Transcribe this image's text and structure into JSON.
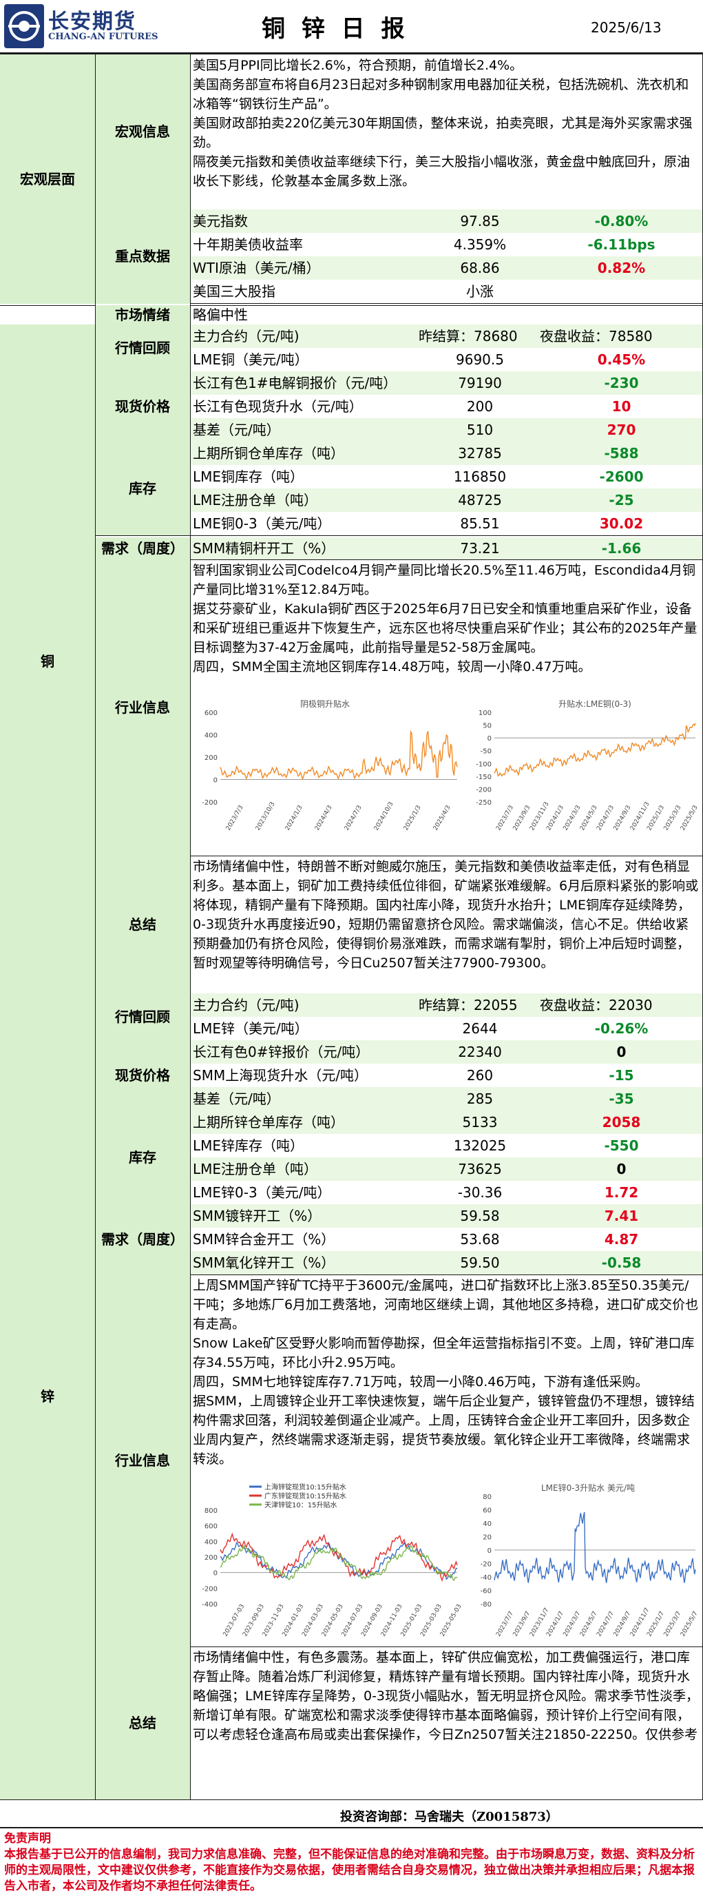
{
  "header": {
    "logo_text": "长安期货",
    "logo_sub": "CHANG-AN FUTURES",
    "title": "铜 锌 日 报",
    "date": "2025/6/13"
  },
  "macro": {
    "section_label": "宏观层面",
    "info_label": "宏观信息",
    "info_paras": [
      "美国5月PPI同比增长2.6%，符合预期，前值增长2.4%。",
      "美国商务部宣布将自6月23日起对多种钢制家用电器加征关税，包括洗碗机、洗衣机和冰箱等“钢铁衍生产品”。",
      "美国财政部拍卖220亿美元30年期国债，整体来说，拍卖亮眼，尤其是海外买家需求强劲。",
      "隔夜美元指数和美债收益率继续下行，美三大股指小幅收涨，黄金盘中触底回升，原油收长下影线，伦敦基本金属多数上涨。"
    ],
    "key_label": "重点数据",
    "key_rows": [
      {
        "name": "美元指数",
        "value": "97.85",
        "change": "-0.80%",
        "color": "green"
      },
      {
        "name": "十年期美债收益率",
        "value": "4.359%",
        "change": "-6.11bps",
        "color": "green"
      },
      {
        "name": "WTI原油（美元/桶）",
        "value": "68.86",
        "change": "0.82%",
        "color": "red"
      },
      {
        "name": "美国三大股指",
        "value": "小涨",
        "change": "",
        "color": "black"
      }
    ],
    "sentiment_label": "市场情绪",
    "sentiment_value": "略偏中性"
  },
  "copper": {
    "section_label": "铜",
    "review_label": "行情回顾",
    "review_rows": [
      {
        "name": "主力合约（元/吨)",
        "value": "昨结算：78680",
        "change": "夜盘收益：78580",
        "color": "black"
      },
      {
        "name": "LME铜（美元/吨）",
        "value": "9690.5",
        "change": "0.45%",
        "color": "red"
      }
    ],
    "spot_label": "现货价格",
    "spot_rows": [
      {
        "name": "长江有色1#电解铜报价（元/吨）",
        "value": "79190",
        "change": "-230",
        "color": "green"
      },
      {
        "name": "长江有色现货升水（元/吨）",
        "value": "200",
        "change": "10",
        "color": "red"
      },
      {
        "name": "基差（元/吨）",
        "value": "510",
        "change": "270",
        "color": "red"
      }
    ],
    "stock_label": "库存",
    "stock_rows": [
      {
        "name": "上期所铜仓单库存（吨）",
        "value": "32785",
        "change": "-588",
        "color": "green"
      },
      {
        "name": "LME铜库存（吨）",
        "value": "116850",
        "change": "-2600",
        "color": "green"
      },
      {
        "name": "LME注册仓单（吨）",
        "value": "48725",
        "change": "-25",
        "color": "green"
      },
      {
        "name": "LME铜0-3（美元/吨）",
        "value": "85.51",
        "change": "30.02",
        "color": "red"
      }
    ],
    "demand_label": "需求（周度）",
    "demand_rows": [
      {
        "name": "SMM精铜杆开工（%）",
        "value": "73.21",
        "change": "-1.66",
        "color": "green"
      }
    ],
    "industry_label": "行业信息",
    "industry_paras": [
      "智利国家铜业公司Codelco4月铜产量同比增长20.5%至11.46万吨，Escondida4月铜产量同比增31%至12.84万吨。",
      "据艾芬豪矿业，Kakula铜矿西区于2025年6月7日已安全和慎重地重启采矿作业，设备和采矿班组已重返井下恢复生产，远东区也将尽快重启采矿作业；其公布的2025年产量目标调整为37-42万金属吨，此前指导量是52-58万金属吨。",
      "周四，SMM全国主流地区铜库存14.48万吨，较周一小降0.47万吨。"
    ],
    "summary_label": "总结",
    "summary_text": "市场情绪偏中性，特朗普不断对鲍威尔施压，美元指数和美债收益率走低，对有色稍显利多。基本面上，铜矿加工费持续低位徘徊，矿端紧张难缓解。6月后原料紧张的影响或将体现，精铜产量有下降预期。国内社库小降，现货升水抬升；LME铜库存延续降势，0-3现货升水再度接近90，短期仍需留意挤仓风险。需求端偏淡，信心不足。供给收紧预期叠加仍有挤仓风险，使得铜价易涨难跌，而需求端有掣肘，铜价上冲后短时调整，暂时观望等待明确信号，今日Cu2507暂关注77900-79300。",
    "chart1": {
      "title": "阴极铜升贴水",
      "ylim": [
        -200,
        600
      ],
      "yticks": [
        "600",
        "400",
        "200",
        "0",
        "-200"
      ],
      "xticks": [
        "2023/7/3",
        "2023/10/3",
        "2024/1/3",
        "2024/4/3",
        "2024/7/3",
        "2024/10/3",
        "2025/1/3",
        "2025/4/3"
      ]
    },
    "chart2": {
      "title": "升贴水:LME铜(0-3)",
      "ylim": [
        -250,
        100
      ],
      "yticks": [
        "100",
        "50",
        "0",
        "-50",
        "-100",
        "-150",
        "-200",
        "-250"
      ],
      "xticks": [
        "2023/7/3",
        "2023/9/3",
        "2023/11/3",
        "2024/1/3",
        "2024/3/3",
        "2024/5/3",
        "2024/7/3",
        "2024/9/3",
        "2024/11/3",
        "2025/1/3",
        "2025/3/3",
        "2025/5/3"
      ]
    }
  },
  "zinc": {
    "section_label": "锌",
    "review_label": "行情回顾",
    "review_rows": [
      {
        "name": "主力合约（元/吨)",
        "value": "昨结算：22055",
        "change": "夜盘收益：22030",
        "color": "black"
      },
      {
        "name": "LME锌（美元/吨）",
        "value": "2644",
        "change": "-0.26%",
        "color": "green"
      }
    ],
    "spot_label": "现货价格",
    "spot_rows": [
      {
        "name": "长江有色0#锌报价（元/吨）",
        "value": "22340",
        "change": "0",
        "color": "black"
      },
      {
        "name": "SMM上海现货升水（元/吨）",
        "value": "260",
        "change": "-15",
        "color": "green"
      },
      {
        "name": "基差（元/吨）",
        "value": "285",
        "change": "-35",
        "color": "green"
      }
    ],
    "stock_label": "库存",
    "stock_rows": [
      {
        "name": "上期所锌仓单库存（吨）",
        "value": "5133",
        "change": "2058",
        "color": "red"
      },
      {
        "name": "LME锌库存（吨）",
        "value": "132025",
        "change": "-550",
        "color": "green"
      },
      {
        "name": "LME注册仓单（吨）",
        "value": "73625",
        "change": "0",
        "color": "black"
      },
      {
        "name": "LME锌0-3（美元/吨）",
        "value": "-30.36",
        "change": "1.72",
        "color": "red"
      }
    ],
    "demand_label": "需求（周度）",
    "demand_rows": [
      {
        "name": "SMM镀锌开工（%）",
        "value": "59.58",
        "change": "7.41",
        "color": "red"
      },
      {
        "name": "SMM锌合金开工（%）",
        "value": "53.68",
        "change": "4.87",
        "color": "red"
      },
      {
        "name": "SMM氧化锌开工（%）",
        "value": "59.50",
        "change": "-0.58",
        "color": "green"
      }
    ],
    "industry_label": "行业信息",
    "industry_paras": [
      "上周SMM国产锌矿TC持平于3600元/金属吨，进口矿指数环比上涨3.85至50.35美元/干吨；多地炼厂6月加工费落地，河南地区继续上调，其他地区多持稳，进口矿成交价也有走高。",
      "Snow Lake矿区受野火影响而暂停勘探，但全年运营指标指引不变。上周，锌矿港口库存34.55万吨，环比小升2.95万吨。",
      "周四，SMM七地锌锭库存7.71万吨，较周一小降0.46万吨，下游有逢低采购。",
      "据SMM，上周镀锌企业开工率快速恢复，端午后企业复产，镀锌管盘仍不理想，镀锌结构件需求回落，利润较差倒逼企业减产。上周，压铸锌合金企业开工率回升，因多数企业周内复产，然终端需求逐渐走弱，提货节奏放缓。氧化锌企业开工率微降，终端需求转淡。"
    ],
    "summary_label": "总结",
    "summary_text": "市场情绪偏中性，有色多震荡。基本面上，锌矿供应偏宽松，加工费偏强运行，港口库存暂止降。随着冶炼厂利润修复，精炼锌产量有增长预期。国内锌社库小降，现货升水略偏强；LME锌库存呈降势，0-3现货小幅贴水，暂无明显挤仓风险。需求季节性淡季，新增订单有限。矿端宽松和需求淡季使得锌市基本面略偏弱，预计锌价上行空间有限，可以考虑轻仓逢高布局或卖出套保操作，今日Zn2507暂关注21850-22250。仅供参考",
    "chart3": {
      "legend": [
        "上海锌锭现货10:15升贴水",
        "广东锌锭现货10:15升贴水",
        "天津锌锭10：15升贴水"
      ],
      "ylim": [
        -400,
        800
      ],
      "yticks": [
        "800",
        "600",
        "400",
        "200",
        "0",
        "-200",
        "-400"
      ],
      "xticks": [
        "2023-07-03",
        "2023-09-03",
        "2023-11-03",
        "2024-01-03",
        "2024-03-03",
        "2024-05-03",
        "2024-07-03",
        "2024-09-03",
        "2024-11-03",
        "2025-01-03",
        "2025-03-03",
        "2025-05-03"
      ]
    },
    "chart4": {
      "title": "LME锌0-3升贴水 美元/吨",
      "ylim": [
        -80,
        80
      ],
      "yticks": [
        "80",
        "60",
        "40",
        "20",
        "0",
        "-20",
        "-40",
        "-60",
        "-80"
      ],
      "xticks": [
        "2023/7/7",
        "2023/9/7",
        "2023/11/7",
        "2024/1/7",
        "2024/3/7",
        "2024/5/7",
        "2024/7/7",
        "2024/9/7",
        "2024/11/7",
        "2025/1/7",
        "2025/3/7",
        "2025/5/7"
      ]
    }
  },
  "footer": {
    "consultant": "投资咨询部：马舍瑞夫（Z0015873）",
    "disclaimer_title": "免责声明",
    "disclaimer_text": "本报告基于已公开的信息编制，我司力求信息准确、完整，但不能保证信息的绝对准确和完整。由于市场瞬息万变，数据、资料及分析师的主观局限性，文中建议仅供参考，不能直接作为交易依据，使用者需结合自身交易情况，独立做出决策并承担相应后果；凡据本报告入市者，本公司及作者均不承担任何法律责任。"
  },
  "colors": {
    "label_bg": "#d9f0cf",
    "row_bg": "#eaf7e2",
    "up": "#e3001b",
    "down": "#0b8a2a",
    "header_blue": "#1f3a7a"
  }
}
